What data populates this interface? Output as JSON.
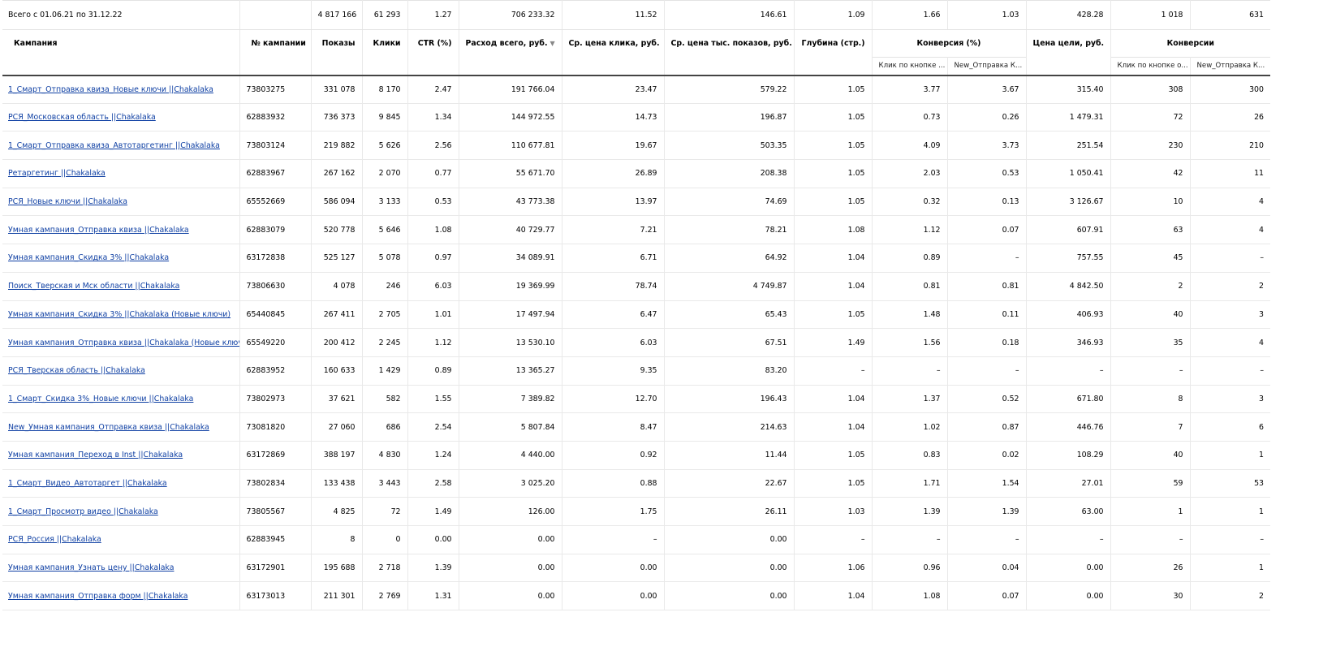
{
  "total": {
    "label": "Всего с 01.06.21 по 31.12.22",
    "values": [
      "",
      "4 817 166",
      "61 293",
      "1.27",
      "706 233.32",
      "11.52",
      "146.61",
      "1.09",
      "1.66",
      "1.03",
      "428.28",
      "1 018",
      "631"
    ]
  },
  "header": {
    "campaign": "Кампания",
    "campaign_id": "№ кампании",
    "impressions": "Показы",
    "clicks": "Клики",
    "ctr": "CTR (%)",
    "spend": "Расход всего, руб.",
    "sort_icon": "▼",
    "cpc": "Ср. цена клика, руб.",
    "cpm": "Ср. цена тыс. показов, руб.",
    "depth": "Глубина (стр.)",
    "conv_rate": "Конверсия (%)",
    "goal_price": "Цена цели, руб.",
    "conversions": "Конверсии",
    "sub_goal1": "Клик по кнопке ...",
    "sub_goal2": "New_Отправка К...",
    "sub_goal1b": "Клик по кнопке о...",
    "sub_goal2b": "New_Отправка К..."
  },
  "rows": [
    [
      "1_Смарт_Отправка квиза_Новые ключи ||Chakalaka",
      "73803275",
      "331 078",
      "8 170",
      "2.47",
      "191 766.04",
      "23.47",
      "579.22",
      "1.05",
      "3.77",
      "3.67",
      "315.40",
      "308",
      "300"
    ],
    [
      "РСЯ_Московская область ||Chakalaka",
      "62883932",
      "736 373",
      "9 845",
      "1.34",
      "144 972.55",
      "14.73",
      "196.87",
      "1.05",
      "0.73",
      "0.26",
      "1 479.31",
      "72",
      "26"
    ],
    [
      "1_Смарт_Отправка квиза_Автотаргетинг ||Chakalaka",
      "73803124",
      "219 882",
      "5 626",
      "2.56",
      "110 677.81",
      "19.67",
      "503.35",
      "1.05",
      "4.09",
      "3.73",
      "251.54",
      "230",
      "210"
    ],
    [
      "Ретаргетинг ||Chakalaka",
      "62883967",
      "267 162",
      "2 070",
      "0.77",
      "55 671.70",
      "26.89",
      "208.38",
      "1.05",
      "2.03",
      "0.53",
      "1 050.41",
      "42",
      "11"
    ],
    [
      "РСЯ_Новые ключи ||Chakalaka",
      "65552669",
      "586 094",
      "3 133",
      "0.53",
      "43 773.38",
      "13.97",
      "74.69",
      "1.05",
      "0.32",
      "0.13",
      "3 126.67",
      "10",
      "4"
    ],
    [
      "Умная кампания_Отправка квиза ||Chakalaka",
      "62883079",
      "520 778",
      "5 646",
      "1.08",
      "40 729.77",
      "7.21",
      "78.21",
      "1.08",
      "1.12",
      "0.07",
      "607.91",
      "63",
      "4"
    ],
    [
      "Умная кампания_Скидка 3% ||Chakalaka",
      "63172838",
      "525 127",
      "5 078",
      "0.97",
      "34 089.91",
      "6.71",
      "64.92",
      "1.04",
      "0.89",
      "–",
      "757.55",
      "45",
      "–"
    ],
    [
      "Поиск_Тверская и Мск области ||Chakalaka",
      "73806630",
      "4 078",
      "246",
      "6.03",
      "19 369.99",
      "78.74",
      "4 749.87",
      "1.04",
      "0.81",
      "0.81",
      "4 842.50",
      "2",
      "2"
    ],
    [
      "Умная кампания_Скидка 3% ||Chakalaka (Новые ключи)",
      "65440845",
      "267 411",
      "2 705",
      "1.01",
      "17 497.94",
      "6.47",
      "65.43",
      "1.05",
      "1.48",
      "0.11",
      "406.93",
      "40",
      "3"
    ],
    [
      "Умная кампания_Отправка квиза ||Chakalaka (Новые ключи)",
      "65549220",
      "200 412",
      "2 245",
      "1.12",
      "13 530.10",
      "6.03",
      "67.51",
      "1.49",
      "1.56",
      "0.18",
      "346.93",
      "35",
      "4"
    ],
    [
      "РСЯ_Тверская область ||Chakalaka",
      "62883952",
      "160 633",
      "1 429",
      "0.89",
      "13 365.27",
      "9.35",
      "83.20",
      "–",
      "–",
      "–",
      "–",
      "–",
      "–"
    ],
    [
      "1_Смарт_Скидка 3%_Новые ключи ||Chakalaka",
      "73802973",
      "37 621",
      "582",
      "1.55",
      "7 389.82",
      "12.70",
      "196.43",
      "1.04",
      "1.37",
      "0.52",
      "671.80",
      "8",
      "3"
    ],
    [
      "New_Умная кампания_Отправка квиза ||Chakalaka",
      "73081820",
      "27 060",
      "686",
      "2.54",
      "5 807.84",
      "8.47",
      "214.63",
      "1.04",
      "1.02",
      "0.87",
      "446.76",
      "7",
      "6"
    ],
    [
      "Умная кампания_Переход в Inst ||Chakalaka",
      "63172869",
      "388 197",
      "4 830",
      "1.24",
      "4 440.00",
      "0.92",
      "11.44",
      "1.05",
      "0.83",
      "0.02",
      "108.29",
      "40",
      "1"
    ],
    [
      "1_Смарт_Видео_Автотаргет ||Chakalaka",
      "73802834",
      "133 438",
      "3 443",
      "2.58",
      "3 025.20",
      "0.88",
      "22.67",
      "1.05",
      "1.71",
      "1.54",
      "27.01",
      "59",
      "53"
    ],
    [
      "1_Смарт_Просмотр видео ||Chakalaka",
      "73805567",
      "4 825",
      "72",
      "1.49",
      "126.00",
      "1.75",
      "26.11",
      "1.03",
      "1.39",
      "1.39",
      "63.00",
      "1",
      "1"
    ],
    [
      "РСЯ_Россия ||Chakalaka",
      "62883945",
      "8",
      "0",
      "0.00",
      "0.00",
      "–",
      "0.00",
      "–",
      "–",
      "–",
      "–",
      "–",
      "–"
    ],
    [
      "Умная кампания_Узнать цену ||Chakalaka",
      "63172901",
      "195 688",
      "2 718",
      "1.39",
      "0.00",
      "0.00",
      "0.00",
      "1.06",
      "0.96",
      "0.04",
      "0.00",
      "26",
      "1"
    ],
    [
      "Умная кампания_Отправка форм ||Chakalaka",
      "63173013",
      "211 301",
      "2 769",
      "1.31",
      "0.00",
      "0.00",
      "0.00",
      "1.04",
      "1.08",
      "0.07",
      "0.00",
      "30",
      "2"
    ]
  ]
}
